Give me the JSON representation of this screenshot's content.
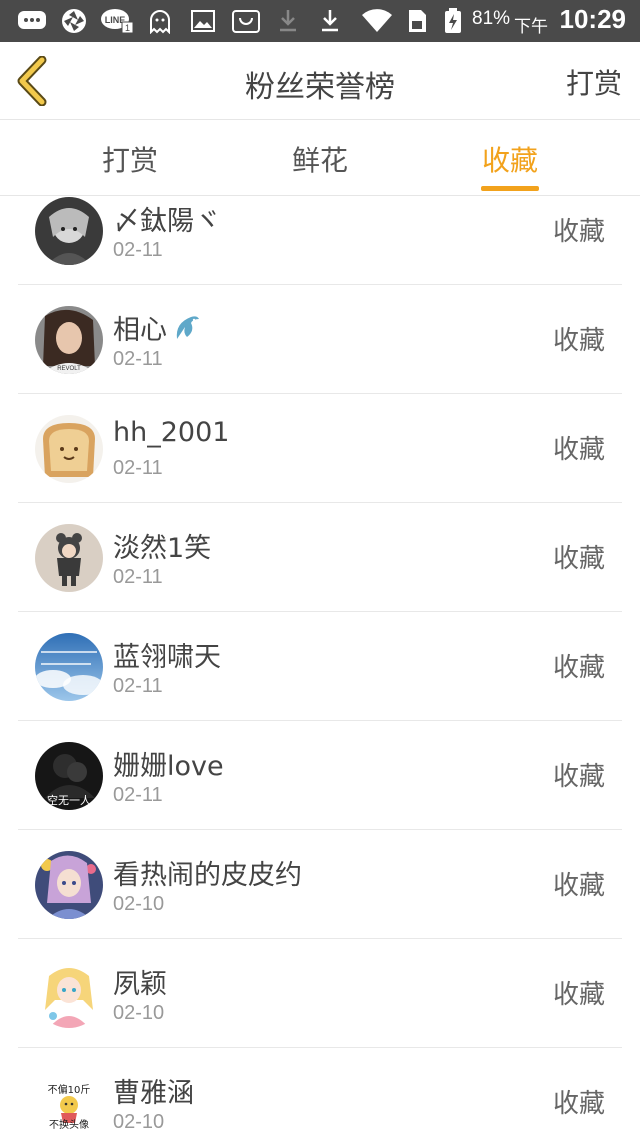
{
  "status_bar": {
    "battery_percent": "81%",
    "am_pm": "下午",
    "time": "10:29",
    "icons": [
      "chat-bubble-icon",
      "aperture-icon",
      "line-app-icon",
      "ghost-notification-icon",
      "image-icon",
      "shopping-bag-icon",
      "download-faded-icon",
      "download-icon",
      "wifi-icon",
      "sim-card-icon",
      "battery-charging-icon"
    ]
  },
  "navbar": {
    "title": "粉丝荣誉榜",
    "right_action": "打赏",
    "back_icon": "chevron-left-icon"
  },
  "tabs": [
    {
      "label": "打赏",
      "active": false
    },
    {
      "label": "鲜花",
      "active": false
    },
    {
      "label": "收藏",
      "active": true
    }
  ],
  "accent_color": "#f2a21c",
  "fans": [
    {
      "name": "〆鈦陽ヾ",
      "date": "02-11",
      "action": "收藏",
      "avatar": "anime-girl-dark-avatar"
    },
    {
      "name": "相心",
      "date": "02-11",
      "action": "收藏",
      "avatar": "woman-portrait-avatar",
      "badge": "dolphin-icon"
    },
    {
      "name": "hh_2001",
      "date": "02-11",
      "action": "收藏",
      "avatar": "toast-face-avatar"
    },
    {
      "name": "淡然1笑",
      "date": "02-11",
      "action": "收藏",
      "avatar": "child-bear-hat-avatar"
    },
    {
      "name": "蓝翎啸天",
      "date": "02-11",
      "action": "收藏",
      "avatar": "blue-sky-text-avatar"
    },
    {
      "name": "姗姗love",
      "date": "02-11",
      "action": "收藏",
      "avatar": "dark-couple-avatar",
      "avatar_caption": "空无一人"
    },
    {
      "name": "看热闹的皮皮约",
      "date": "02-10",
      "action": "收藏",
      "avatar": "anime-flower-girl-avatar"
    },
    {
      "name": "夙颖",
      "date": "02-10",
      "action": "收藏",
      "avatar": "blonde-anime-girl-avatar"
    },
    {
      "name": "曹雅涵",
      "date": "02-10",
      "action": "收藏",
      "avatar": "cartoon-text-avatar",
      "avatar_caption_top": "不偏10斤",
      "avatar_caption_bottom": "不换头像"
    }
  ]
}
